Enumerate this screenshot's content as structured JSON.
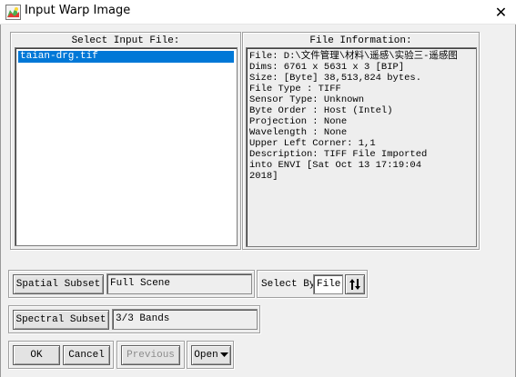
{
  "window": {
    "title": "Input Warp Image",
    "close_glyph": "✕"
  },
  "select_input": {
    "label": "Select Input File:",
    "files": [
      "taian-drg.tif"
    ]
  },
  "file_info": {
    "label": "File Information:",
    "lines": [
      "File: D:\\文件管理\\材料\\遥感\\实验三-遥感图",
      "Dims: 6761 x 5631 x 3 [BIP]",
      "Size: [Byte] 38,513,824 bytes.",
      "File Type  : TIFF",
      "Sensor Type: Unknown",
      "Byte Order : Host (Intel)",
      "Projection : None",
      "Wavelength : None",
      "Upper Left Corner: 1,1",
      "Description: TIFF File Imported",
      "into ENVI [Sat Oct 13 17:19:04",
      "2018]"
    ]
  },
  "spatial_subset": {
    "button_label": "Spatial Subset",
    "value": "Full Scene"
  },
  "select_by": {
    "label": "Select By",
    "value": "File",
    "toggle_icon": "sort-arrows-icon"
  },
  "spectral_subset": {
    "button_label": "Spectral Subset",
    "value": "3/3 Bands"
  },
  "buttons": {
    "ok": "OK",
    "cancel": "Cancel",
    "previous": "Previous",
    "open": "Open"
  }
}
